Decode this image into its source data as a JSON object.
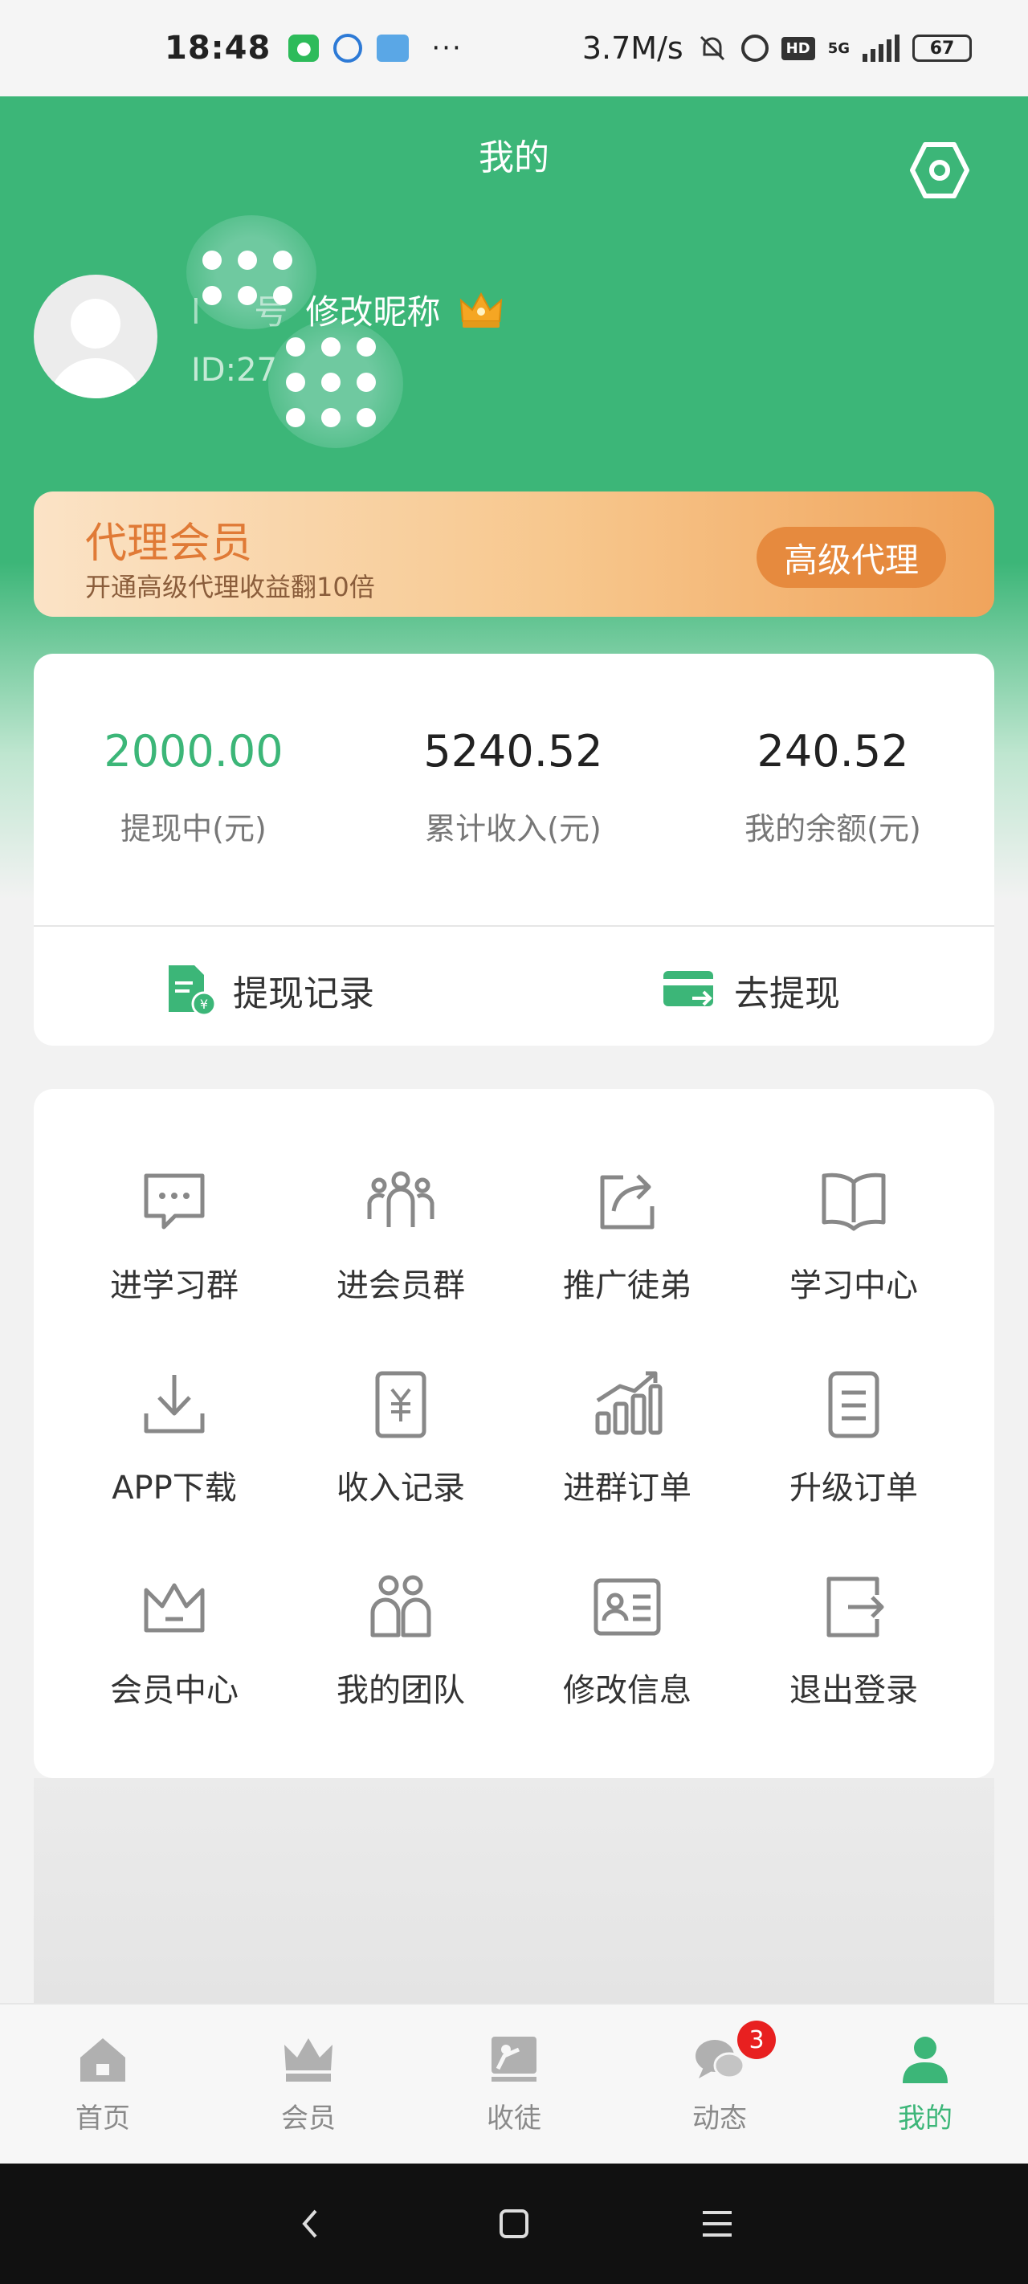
{
  "status_bar": {
    "time": "18:48",
    "net_speed": "3.7M/s",
    "network": "5G",
    "battery": "67",
    "hd": "HD",
    "more": "···"
  },
  "header": {
    "title": "我的"
  },
  "profile": {
    "name_masked": "l     号",
    "edit_nickname": "修改昵称",
    "id": "ID:27"
  },
  "vip": {
    "title": "代理会员",
    "subtitle": "开通高级代理收益翻10倍",
    "button": "高级代理"
  },
  "balance": {
    "withdrawing": {
      "value": "2000.00",
      "label": "提现中(元)"
    },
    "total_income": {
      "value": "5240.52",
      "label": "累计收入(元)"
    },
    "my_balance": {
      "value": "240.52",
      "label": "我的余额(元)"
    },
    "withdraw_records": "提现记录",
    "withdraw": "去提现"
  },
  "menu": {
    "items": [
      {
        "label": "进学习群",
        "icon": "chat-dots-icon"
      },
      {
        "label": "进会员群",
        "icon": "group-icon"
      },
      {
        "label": "推广徒弟",
        "icon": "share-icon"
      },
      {
        "label": "学习中心",
        "icon": "book-icon"
      },
      {
        "label": "APP下载",
        "icon": "download-icon"
      },
      {
        "label": "收入记录",
        "icon": "yuan-doc-icon"
      },
      {
        "label": "进群订单",
        "icon": "bar-chart-icon"
      },
      {
        "label": "升级订单",
        "icon": "list-doc-icon"
      },
      {
        "label": "会员中心",
        "icon": "crown-icon"
      },
      {
        "label": "我的团队",
        "icon": "team-icon"
      },
      {
        "label": "修改信息",
        "icon": "id-card-icon"
      },
      {
        "label": "退出登录",
        "icon": "logout-icon"
      }
    ]
  },
  "tabbar": {
    "items": [
      {
        "label": "首页",
        "icon": "home-icon"
      },
      {
        "label": "会员",
        "icon": "crown-icon"
      },
      {
        "label": "收徒",
        "icon": "teach-icon"
      },
      {
        "label": "动态",
        "icon": "chat-bubbles-icon",
        "badge": "3"
      },
      {
        "label": "我的",
        "icon": "user-icon"
      }
    ]
  },
  "colors": {
    "primary": "#3cb678",
    "vip_orange": "#e68a3e",
    "badge_red": "#e82020"
  }
}
